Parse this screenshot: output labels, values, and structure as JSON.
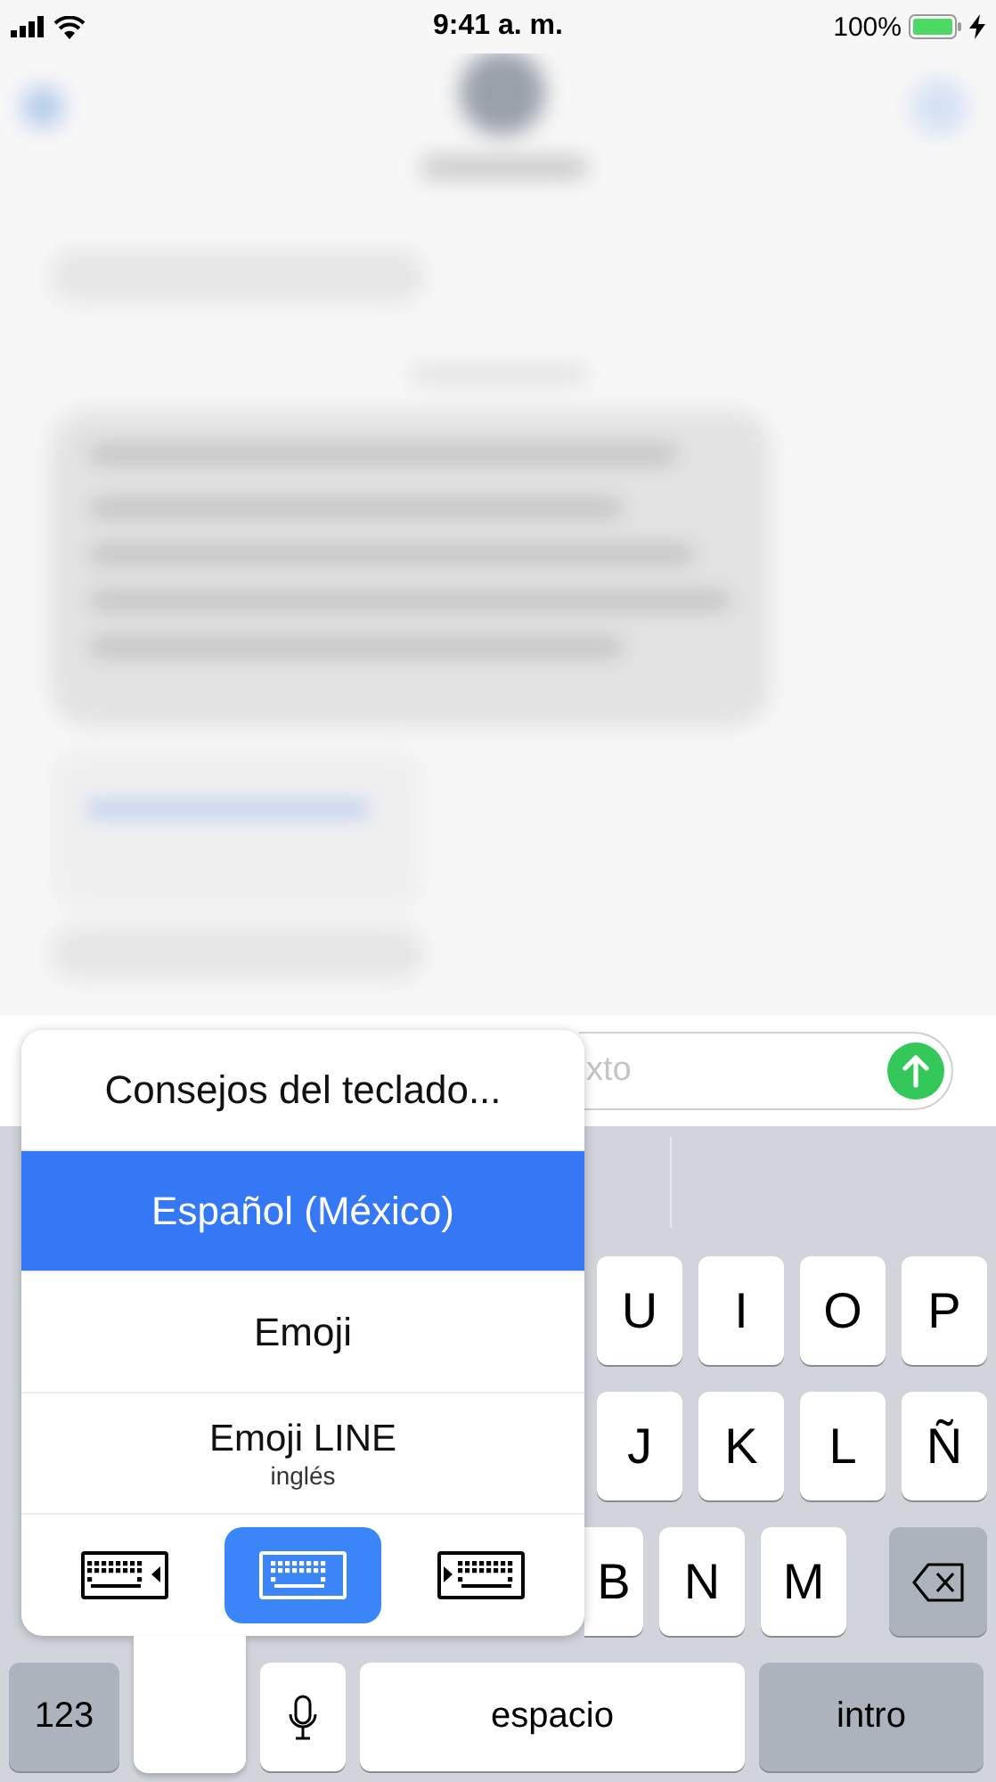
{
  "status_bar": {
    "time": "9:41 a. m.",
    "battery_percent": "100%",
    "charging": true
  },
  "message_field": {
    "placeholder": "xto"
  },
  "keyboard": {
    "rows": [
      [
        "U",
        "I",
        "O",
        "P"
      ],
      [
        "J",
        "K",
        "L",
        "Ñ"
      ],
      [
        "B",
        "N",
        "M"
      ]
    ],
    "numbers_key": "123",
    "space_key": "espacio",
    "return_key": "intro"
  },
  "keyboard_menu": {
    "items": [
      {
        "label": "Consejos del teclado...",
        "selected": false
      },
      {
        "label": "Español (México)",
        "selected": true
      },
      {
        "label": "Emoji",
        "selected": false
      },
      {
        "label": "Emoji LINE",
        "subtitle": "inglés",
        "selected": false
      }
    ],
    "layout_options": [
      {
        "kind": "left",
        "selected": false
      },
      {
        "kind": "full",
        "selected": true
      },
      {
        "kind": "right",
        "selected": false
      }
    ]
  }
}
